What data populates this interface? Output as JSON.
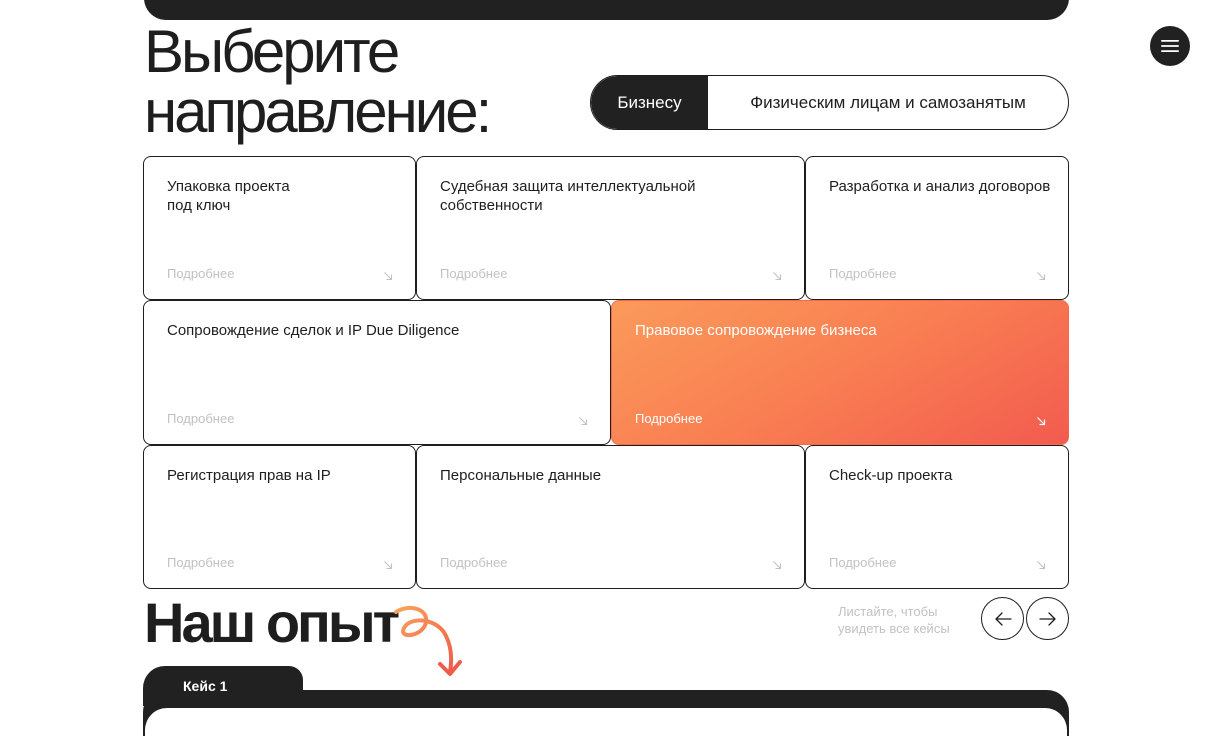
{
  "header": {
    "title_line1": "Выберите",
    "title_line2": "направление:"
  },
  "toggle": {
    "business": "Бизнесу",
    "individuals": "Физическим лицам и самозанятым"
  },
  "services": [
    {
      "title": "Упаковка проекта\nпод ключ",
      "more": "Подробнее"
    },
    {
      "title": "Судебная защита интеллектуальной\nсобственности",
      "more": "Подробнее"
    },
    {
      "title": "Разработка и анализ договоров",
      "more": "Подробнее"
    },
    {
      "title": "Сопровождение сделок и IP Due Diligence",
      "more": "Подробнее"
    },
    {
      "title": "Правовое сопровождение бизнеса",
      "more": "Подробнее"
    },
    {
      "title": "Регистрация прав на IP",
      "more": "Подробнее"
    },
    {
      "title": "Персональные данные",
      "more": "Подробнее"
    },
    {
      "title": "Check-up проекта",
      "more": "Подробнее"
    }
  ],
  "experience": {
    "title": "Наш опыт",
    "hint": "Листайте, чтобы увидеть все кейсы",
    "case_tab": "Кейс 1"
  },
  "icons": {
    "menu": "menu-icon",
    "card_arrow": "arrow-down-right-icon",
    "prev": "arrow-left-icon",
    "next": "arrow-right-icon",
    "squiggle": "squiggle-arrow-icon"
  },
  "colors": {
    "dark": "#212121",
    "accent_from": "#fb9a5b",
    "accent_to": "#f25b4f",
    "muted": "#c2c2c2"
  }
}
